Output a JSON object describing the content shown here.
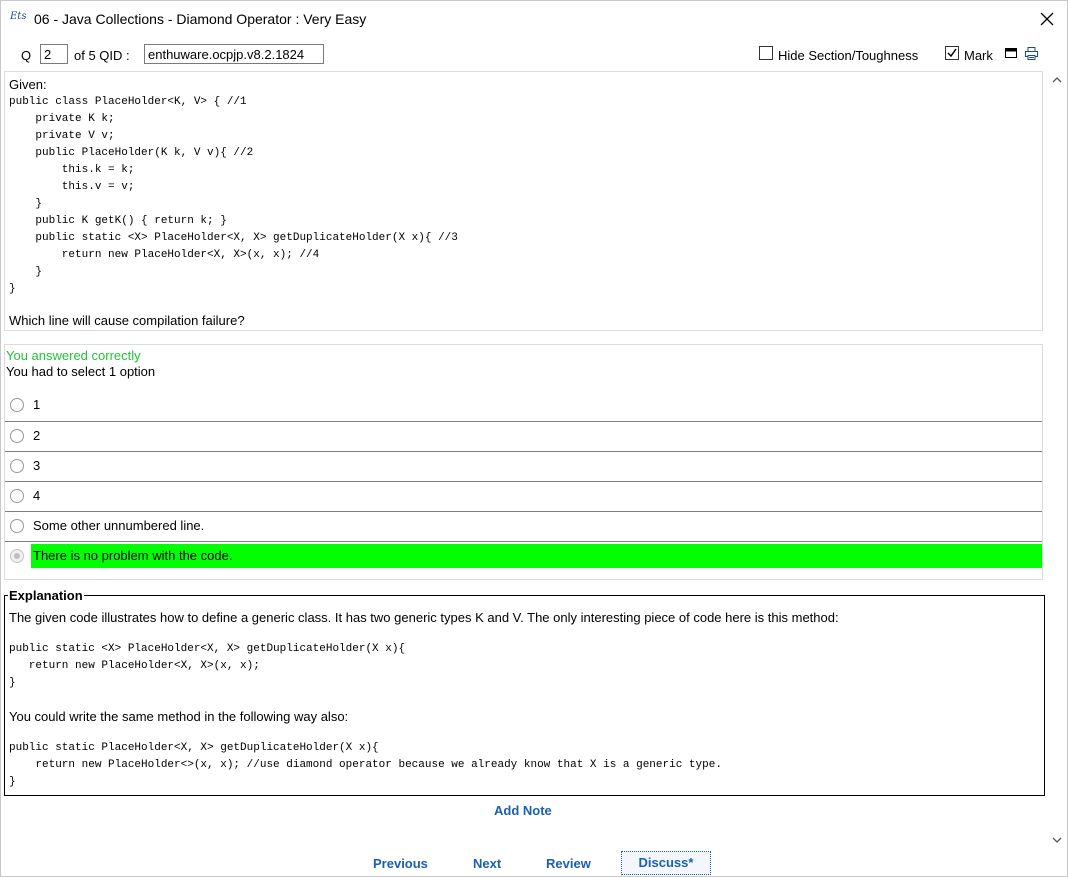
{
  "window": {
    "app_icon_text": "Ets",
    "title": "06 - Java Collections - Diamond Operator",
    "title_sep": ":",
    "difficulty": "Very Easy"
  },
  "toolbar": {
    "q_label": "Q",
    "q_value": "2",
    "of_label": "of 5 QID :",
    "qid_value": "enthuware.ocpjp.v8.2.1824",
    "hide_label": "Hide Section/Toughness",
    "mark_label": "Mark",
    "mark_checked": true,
    "hide_checked": false
  },
  "question": {
    "given": "Given:",
    "code": "public class PlaceHolder<K, V> { //1\n    private K k;\n    private V v;\n    public PlaceHolder(K k, V v){ //2\n        this.k = k;\n        this.v = v;\n    }\n    public K getK() { return k; }\n    public static <X> PlaceHolder<X, X> getDuplicateHolder(X x){ //3\n        return new PlaceHolder<X, X>(x, x); //4\n    }\n}",
    "prompt": "Which line will cause compilation failure?"
  },
  "answer": {
    "status": "You answered correctly",
    "instruction": "You had to select 1 option",
    "options": [
      {
        "label": "1"
      },
      {
        "label": "2"
      },
      {
        "label": "3"
      },
      {
        "label": "4"
      },
      {
        "label": "Some other unnumbered line."
      },
      {
        "label": "There is no problem with the code."
      }
    ],
    "highlight_color": "#00ff00",
    "status_color": "#22c33a"
  },
  "explanation": {
    "legend": "Explanation",
    "p1": "The given code illustrates how to define a generic class. It has two generic types K and V. The only interesting piece of code here is this method:",
    "code1": "public static <X> PlaceHolder<X, X> getDuplicateHolder(X x){\n   return new PlaceHolder<X, X>(x, x);\n}",
    "p2": "You could write the same method in the following way also:",
    "code2": "public static PlaceHolder<X, X> getDuplicateHolder(X x){\n    return new PlaceHolder<>(x, x); //use diamond operator because we already know that X is a generic type.\n}"
  },
  "footer": {
    "add_note": "Add Note",
    "previous": "Previous",
    "next": "Next",
    "review": "Review",
    "discuss": "Discuss*",
    "link_color": "#1a5fb4"
  }
}
